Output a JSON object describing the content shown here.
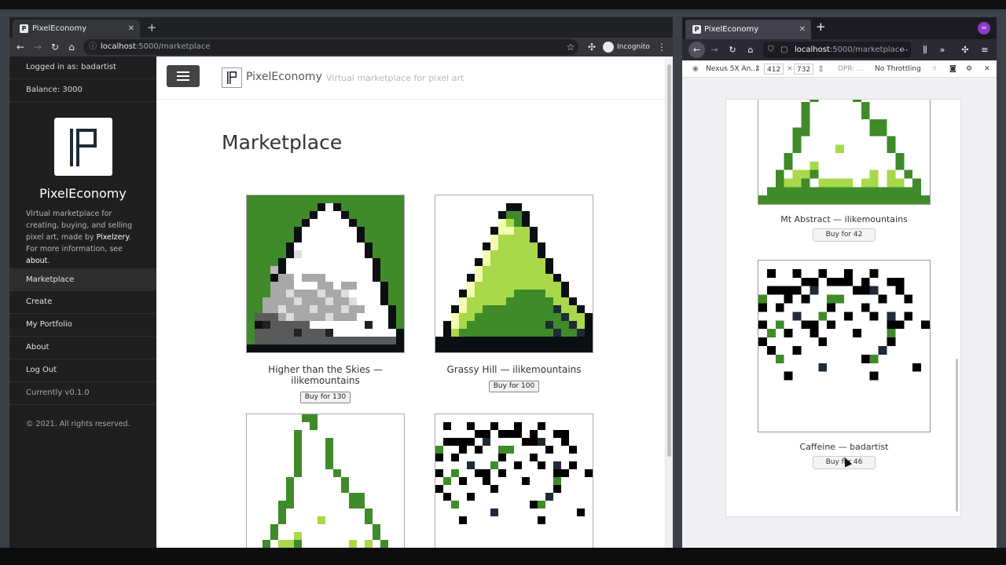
{
  "chrome": {
    "tab_title": "PixelEconomy",
    "url_host": "localhost",
    "url_path": ":5000/marketplace",
    "incognito_label": "Incognito"
  },
  "sidebar": {
    "logged_in": "Logged in as: badartist",
    "balance": "Balance: 3000",
    "title": "PixelEconomy",
    "desc_1": "Virtual marketplace for creating, buying, and selling pixel art, made by ",
    "desc_link": "Pixelzery",
    "desc_2": ".",
    "desc_3": "For more information, see ",
    "desc_about": "about",
    "desc_4": ".",
    "nav": [
      "Marketplace",
      "Create",
      "My Portfolio",
      "About",
      "Log Out"
    ],
    "version": "Currently v0.1.0",
    "copyright": "© 2021. All rights reserved."
  },
  "header": {
    "brand": "PixelEconomy",
    "tagline": "Virtual marketplace for pixel art"
  },
  "page": {
    "title": "Marketplace",
    "cards": [
      {
        "caption": "Higher than the Skies — ilikemountains",
        "buy": "Buy for 130"
      },
      {
        "caption": "Grassy Hill — ilikemountains",
        "buy": "Buy for 100"
      }
    ]
  },
  "firefox": {
    "tab_title": "PixelEconomy",
    "url_host": "localhost",
    "url_path": ":5000/marketplace",
    "device": "Nexus 5X An...",
    "width": "412",
    "times": "×",
    "height": "732",
    "dpr": "DPR: ...",
    "throttling": "No Throttling",
    "cards": [
      {
        "caption": "Mt Abstract — ilikemountains",
        "buy": "Buy for 42"
      },
      {
        "caption": "Caffeine — badartist",
        "buy": "Buy for 46"
      }
    ]
  },
  "colors": {
    "dark_green": "#3f8b2a",
    "light_green": "#a9d84a",
    "pale_green": "#f3ffb0",
    "near_black": "#0b0f14",
    "navy": "#1e2a36"
  }
}
